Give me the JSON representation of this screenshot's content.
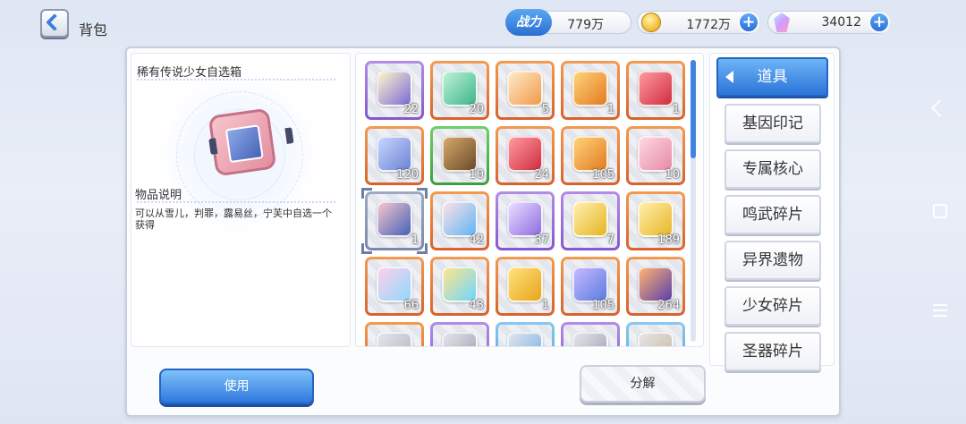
{
  "header": {
    "title": "背包",
    "power_label": "战力",
    "power_value": "779万",
    "gold_value": "1772万",
    "gem_value": "34012",
    "plus_label": "+"
  },
  "detail": {
    "item_name": "稀有传说少女自选箱",
    "desc_label": "物品说明",
    "desc_text": "可以从雪儿，判罪，露易丝，宁芙中自选一个获得"
  },
  "items": [
    {
      "count": "22",
      "rarity": "purple",
      "art": "lamp-card-icon",
      "colors": [
        "#fff7c8",
        "#7b6ad8"
      ]
    },
    {
      "count": "20",
      "rarity": "orange",
      "art": "green-orb-icon",
      "colors": [
        "#bff2d6",
        "#3db58b"
      ]
    },
    {
      "count": "5",
      "rarity": "orange",
      "art": "orange-orb-icon",
      "colors": [
        "#ffe9c8",
        "#f09a4a"
      ]
    },
    {
      "count": "1",
      "rarity": "orange",
      "art": "gold-silhouette-box-icon",
      "colors": [
        "#ffd37a",
        "#e37a1f"
      ]
    },
    {
      "count": "1",
      "rarity": "orange",
      "art": "red-silhouette-box-icon",
      "colors": [
        "#ff9aa2",
        "#cf2d3d"
      ]
    },
    {
      "count": "120",
      "rarity": "orange",
      "art": "winged-box-icon",
      "colors": [
        "#c9d6ff",
        "#6a83d4"
      ]
    },
    {
      "count": "10",
      "rarity": "green",
      "art": "treasure-chest-icon",
      "colors": [
        "#d6a86a",
        "#6b4a2a"
      ]
    },
    {
      "count": "24",
      "rarity": "orange",
      "art": "red-silhouette-box-icon",
      "colors": [
        "#ff9aa2",
        "#cf2d3d"
      ]
    },
    {
      "count": "105",
      "rarity": "orange",
      "art": "gold-silhouette-box-icon",
      "colors": [
        "#ffd37a",
        "#e37a1f"
      ]
    },
    {
      "count": "10",
      "rarity": "orange",
      "art": "pink-gift-box-icon",
      "colors": [
        "#ffd6e2",
        "#e58ba6"
      ]
    },
    {
      "count": "1",
      "rarity": "orange",
      "art": "legend-select-box-icon",
      "colors": [
        "#f7c5cc",
        "#4462b8"
      ],
      "selected": true
    },
    {
      "count": "42",
      "rarity": "orange",
      "art": "shirt-ticket-icon",
      "colors": [
        "#ffe0e8",
        "#5fb6f2"
      ]
    },
    {
      "count": "37",
      "rarity": "purple",
      "art": "smile-ticket-icon",
      "colors": [
        "#e9ddff",
        "#8f6ce0"
      ]
    },
    {
      "count": "7",
      "rarity": "purple",
      "art": "dna-card-icon",
      "colors": [
        "#fff0b0",
        "#e6b422"
      ]
    },
    {
      "count": "189",
      "rarity": "orange",
      "art": "gold-card-icon",
      "colors": [
        "#fff0a8",
        "#e8b52a"
      ]
    },
    {
      "count": "66",
      "rarity": "orange",
      "art": "rainbow-dna-card-icon",
      "colors": [
        "#ffd0e8",
        "#8fd8ff"
      ]
    },
    {
      "count": "43",
      "rarity": "orange",
      "art": "rainbow-ticket-icon",
      "colors": [
        "#ffe68a",
        "#6fd6ff"
      ]
    },
    {
      "count": "1",
      "rarity": "orange",
      "art": "sword-card-icon",
      "colors": [
        "#ffe27a",
        "#e8a41f"
      ]
    },
    {
      "count": "105",
      "rarity": "orange",
      "art": "blue-sword-card-icon",
      "colors": [
        "#c6b8ff",
        "#5a7de0"
      ]
    },
    {
      "count": "264",
      "rarity": "orange",
      "art": "crystal-shard-icon",
      "colors": [
        "#ffb36b",
        "#5a3fb0"
      ]
    },
    {
      "count": "",
      "rarity": "orange",
      "art": "partial-item-icon",
      "colors": [
        "#e4e4ea",
        "#b0b4c2"
      ]
    },
    {
      "count": "",
      "rarity": "purple",
      "art": "partial-item-icon",
      "colors": [
        "#e4e4ea",
        "#9a9eb0"
      ]
    },
    {
      "count": "",
      "rarity": "blue",
      "art": "partial-item-icon",
      "colors": [
        "#e4e4ea",
        "#6fb0e8"
      ]
    },
    {
      "count": "",
      "rarity": "purple",
      "art": "partial-item-icon",
      "colors": [
        "#e4e4ea",
        "#9a9eb0"
      ]
    },
    {
      "count": "",
      "rarity": "blue",
      "art": "partial-item-icon",
      "colors": [
        "#e4e4ea",
        "#c8b89a"
      ]
    }
  ],
  "categories": [
    {
      "label": "道具",
      "active": true
    },
    {
      "label": "基因印记",
      "active": false
    },
    {
      "label": "专属核心",
      "active": false
    },
    {
      "label": "鸣武碎片",
      "active": false
    },
    {
      "label": "异界遗物",
      "active": false
    },
    {
      "label": "少女碎片",
      "active": false
    },
    {
      "label": "圣器碎片",
      "active": false
    }
  ],
  "actions": {
    "use_label": "使用",
    "decompose_label": "分解"
  },
  "scroll": {
    "position_fraction": 0.0,
    "visible_fraction": 0.35
  }
}
